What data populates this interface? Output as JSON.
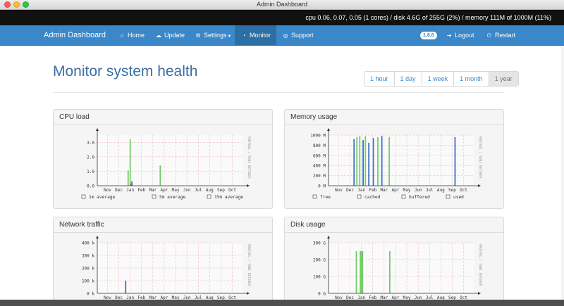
{
  "window": {
    "title": "Admin Dashboard"
  },
  "status": {
    "text": "cpu 0.06, 0.07, 0.05 (1 cores)  /  disk 4.6G of 255G (2%)  /  memory 111M of 1000M (11%)"
  },
  "nav": {
    "brand": "Admin Dashboard",
    "items": [
      {
        "label": "Home",
        "icon": "home-icon"
      },
      {
        "label": "Update",
        "icon": "cloud-download-icon"
      },
      {
        "label": "Settings",
        "icon": "gears-icon"
      },
      {
        "label": "Monitor",
        "icon": "dashboard-icon"
      },
      {
        "label": "Support",
        "icon": "lifebuoy-icon"
      }
    ],
    "version": "1.8.6",
    "logout": "Logout",
    "restart": "Restart"
  },
  "page": {
    "title": "Monitor system health",
    "ranges": [
      "1 hour",
      "1 day",
      "1 week",
      "1 month",
      "1 year"
    ],
    "selected_range": "1 year"
  },
  "chart_data": [
    {
      "title": "CPU load",
      "type": "area",
      "x": [
        "Nov",
        "Dec",
        "Jan",
        "Feb",
        "Mar",
        "Apr",
        "May",
        "Jun",
        "Jul",
        "Aug",
        "Sep",
        "Oct"
      ],
      "yticks": [
        "0.0",
        "1.0",
        "2.0",
        "3.0"
      ],
      "ylim": [
        0,
        3.5
      ],
      "side_label": "RRDTOOL / TOBI OETIKER",
      "legend": [
        "1m average",
        "5m average",
        "15m average"
      ],
      "spikes": [
        {
          "x": 2.0,
          "value": 3.2,
          "color": "#76cc6a"
        },
        {
          "x": 1.82,
          "value": 1.05,
          "color": "#76cc6a"
        },
        {
          "x": 2.15,
          "value": 0.3,
          "color": "#3e6fc9"
        },
        {
          "x": 2.05,
          "value": 0.15,
          "color": "#e24a3b"
        },
        {
          "x": 4.65,
          "value": 1.4,
          "color": "#76cc6a"
        }
      ]
    },
    {
      "title": "Memory usage",
      "type": "area",
      "x": [
        "Nov",
        "Dec",
        "Jan",
        "Feb",
        "Mar",
        "Apr",
        "May",
        "Jun",
        "Jul",
        "Aug",
        "Sep",
        "Oct"
      ],
      "yticks": [
        "0 M",
        "200 M",
        "400 M",
        "600 M",
        "800 M",
        "1000 M"
      ],
      "ylim": [
        0,
        1000
      ],
      "side_label": "RRDTOOL / TOBI OETIKER",
      "legend": [
        "free",
        "cached",
        "buffered",
        "used"
      ],
      "spikes": [
        {
          "x": 1.35,
          "value": 920,
          "color": "#3e6fc9"
        },
        {
          "x": 1.6,
          "value": 960,
          "color": "#76cc6a"
        },
        {
          "x": 1.85,
          "value": 980,
          "color": "#76cc6a"
        },
        {
          "x": 2.15,
          "value": 900,
          "color": "#3e6fc9"
        },
        {
          "x": 2.35,
          "value": 980,
          "color": "#76cc6a"
        },
        {
          "x": 2.65,
          "value": 850,
          "color": "#3e6fc9"
        },
        {
          "x": 3.05,
          "value": 940,
          "color": "#3e6fc9"
        },
        {
          "x": 3.45,
          "value": 960,
          "color": "#76cc6a"
        },
        {
          "x": 3.8,
          "value": 980,
          "color": "#3e6fc9"
        },
        {
          "x": 4.45,
          "value": 960,
          "color": "#76cc6a"
        },
        {
          "x": 10.25,
          "value": 960,
          "color": "#3e6fc9"
        }
      ]
    },
    {
      "title": "Network traffic",
      "type": "area",
      "x": [
        "Nov",
        "Dec",
        "Jan",
        "Feb",
        "Mar",
        "Apr",
        "May",
        "Jun",
        "Jul",
        "Aug",
        "Sep",
        "Oct"
      ],
      "yticks": [
        "0 k",
        "100 k",
        "200 k",
        "300 k",
        "400 k"
      ],
      "ylim": [
        0,
        400
      ],
      "side_label": "RRDTOOL / TOBI OETIKER",
      "legend": [],
      "spikes": [
        {
          "x": 1.6,
          "value": 100,
          "color": "#3e6fc9"
        }
      ]
    },
    {
      "title": "Disk usage",
      "type": "area",
      "x": [
        "Nov",
        "Dec",
        "Jan",
        "Feb",
        "Mar",
        "Apr",
        "May",
        "Jun",
        "Jul",
        "Aug",
        "Sep",
        "Oct"
      ],
      "yticks": [
        "0 G",
        "100 G",
        "200 G",
        "300 G"
      ],
      "ylim": [
        0,
        300
      ],
      "side_label": "RRDTOOL / TOBI OETIKER",
      "legend": [],
      "spikes": [
        {
          "x": 1.55,
          "value": 250,
          "color": "#76cc6a"
        },
        {
          "x": 1.9,
          "value": 250,
          "color": "#76cc6a"
        },
        {
          "x": 2.0,
          "value": 250,
          "color": "#76cc6a"
        },
        {
          "x": 2.1,
          "value": 250,
          "color": "#76cc6a"
        },
        {
          "x": 4.5,
          "value": 250,
          "color": "#76cc6a"
        }
      ]
    }
  ]
}
